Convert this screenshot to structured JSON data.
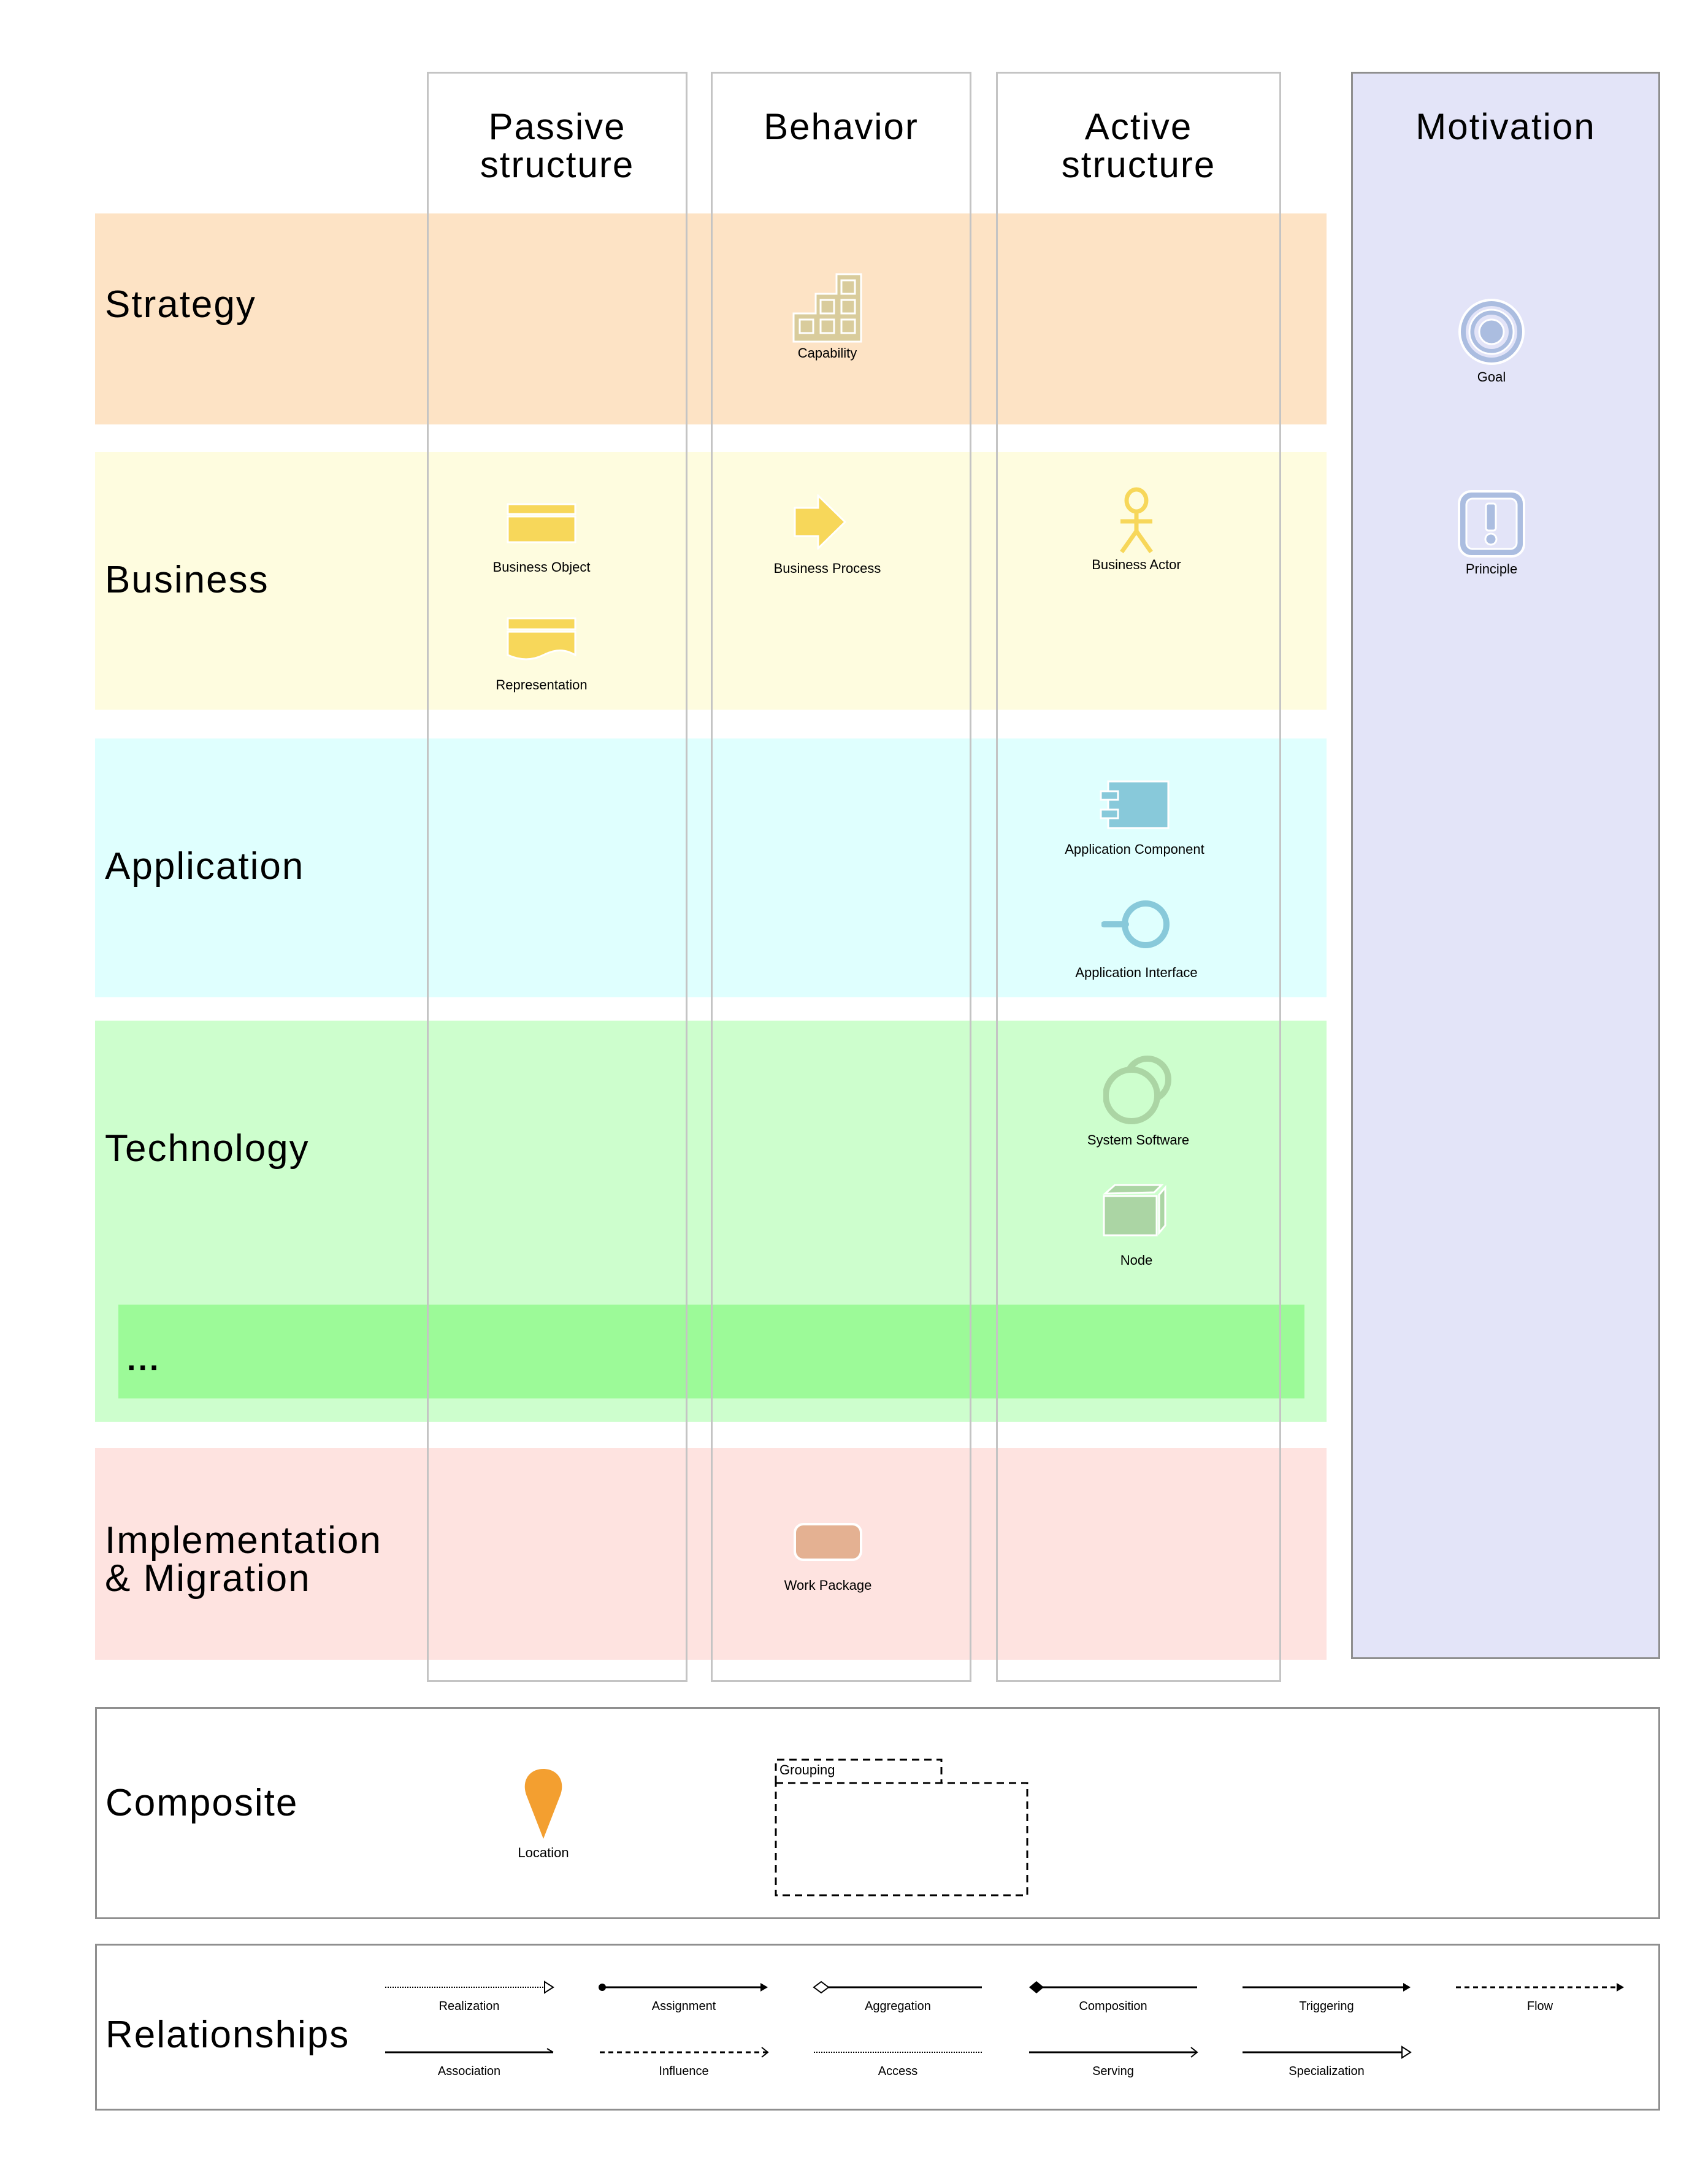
{
  "columns": [
    {
      "id": "passive",
      "title": "Passive\nstructure"
    },
    {
      "id": "behavior",
      "title": "Behavior"
    },
    {
      "id": "active",
      "title": "Active\nstructure"
    }
  ],
  "motivation": {
    "title": "Motivation",
    "color": "#e3e4f8",
    "elements": [
      {
        "label": "Goal",
        "icon": "goal-icon"
      },
      {
        "label": "Principle",
        "icon": "principle-icon"
      }
    ]
  },
  "layers": [
    {
      "id": "strategy",
      "label": "Strategy",
      "color": "#fde3c5",
      "elements": [
        {
          "column": "behavior",
          "label": "Capability",
          "icon": "capability-icon"
        }
      ]
    },
    {
      "id": "business",
      "label": "Business",
      "color": "#fefcdf",
      "elements": [
        {
          "column": "passive",
          "label": "Business Object",
          "icon": "business-object-icon"
        },
        {
          "column": "passive",
          "label": "Representation",
          "icon": "representation-icon"
        },
        {
          "column": "behavior",
          "label": "Business Process",
          "icon": "business-process-icon"
        },
        {
          "column": "active",
          "label": "Business Actor",
          "icon": "business-actor-icon"
        }
      ]
    },
    {
      "id": "application",
      "label": "Application",
      "color": "#dffffe",
      "elements": [
        {
          "column": "active",
          "label": "Application Component",
          "icon": "application-component-icon"
        },
        {
          "column": "active",
          "label": "Application Interface",
          "icon": "application-interface-icon"
        }
      ]
    },
    {
      "id": "technology",
      "label": "Technology",
      "color": "#cdfecd",
      "sublayer": {
        "label": "...",
        "color": "#9cfa98"
      },
      "elements": [
        {
          "column": "active",
          "label": "System Software",
          "icon": "system-software-icon"
        },
        {
          "column": "active",
          "label": "Node",
          "icon": "node-icon"
        }
      ]
    },
    {
      "id": "implementation",
      "label": "Implementation\n& Migration",
      "color": "#fee3e0",
      "elements": [
        {
          "column": "behavior",
          "label": "Work Package",
          "icon": "work-package-icon"
        }
      ]
    }
  ],
  "composite": {
    "label": "Composite",
    "elements": [
      {
        "label": "Location",
        "icon": "location-pin-icon",
        "color": "#f39f30"
      },
      {
        "label": "Grouping",
        "icon": "grouping-frame"
      }
    ]
  },
  "relationships": {
    "label": "Relationships",
    "items": [
      {
        "label": "Realization",
        "style": "dotted",
        "head": "hollow-triangle"
      },
      {
        "label": "Assignment",
        "style": "solid",
        "head": "filled-triangle",
        "tail": "dot"
      },
      {
        "label": "Aggregation",
        "style": "solid",
        "head": "none",
        "tail": "hollow-diamond"
      },
      {
        "label": "Composition",
        "style": "solid",
        "head": "none",
        "tail": "filled-diamond"
      },
      {
        "label": "Triggering",
        "style": "solid",
        "head": "filled-triangle"
      },
      {
        "label": "Flow",
        "style": "dashed",
        "head": "filled-triangle"
      },
      {
        "label": "Association",
        "style": "solid",
        "head": "half-open"
      },
      {
        "label": "Influence",
        "style": "dashed",
        "head": "open"
      },
      {
        "label": "Access",
        "style": "dotted",
        "head": "none"
      },
      {
        "label": "Serving",
        "style": "solid",
        "head": "open"
      },
      {
        "label": "Specialization",
        "style": "solid",
        "head": "hollow-triangle"
      }
    ]
  }
}
